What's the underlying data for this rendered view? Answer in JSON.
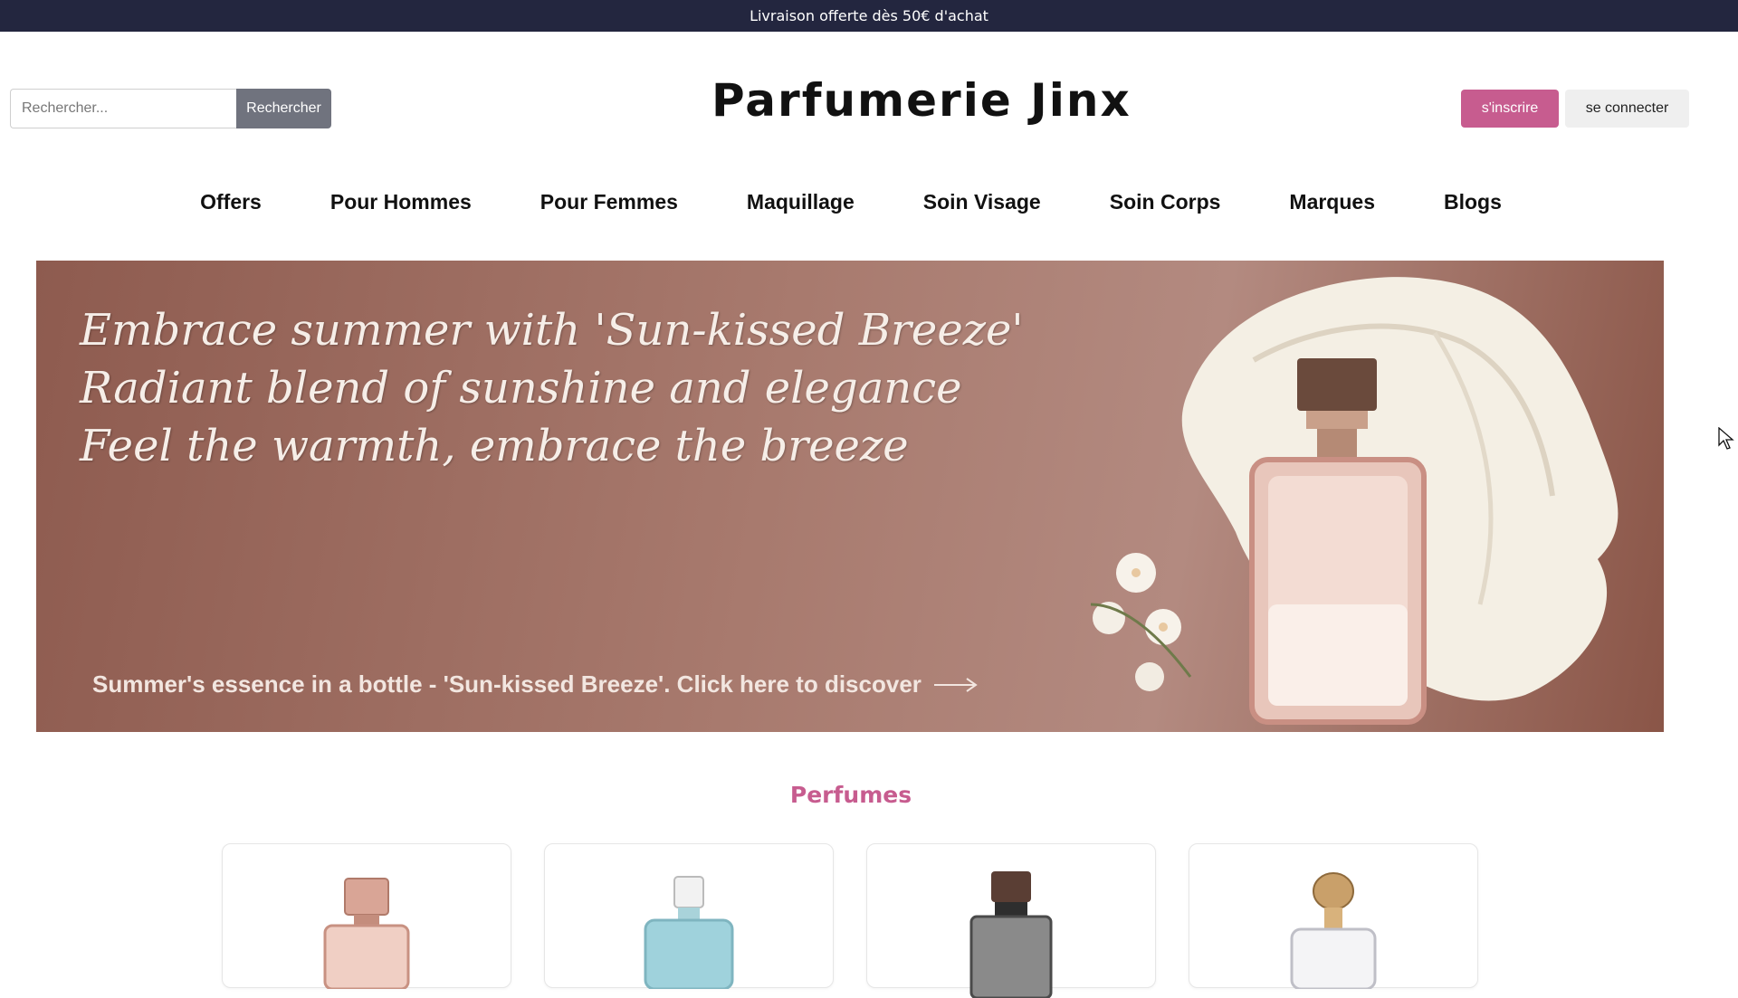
{
  "topbar": {
    "text": "Livraison offerte dès 50€ d'achat"
  },
  "search": {
    "placeholder": "Rechercher...",
    "button_label": "Rechercher"
  },
  "logo": {
    "text": "Parfumerie Jinx"
  },
  "auth": {
    "signup_label": "s'inscrire",
    "login_label": "se connecter"
  },
  "nav": {
    "items": [
      {
        "label": "Offers"
      },
      {
        "label": "Pour Hommes"
      },
      {
        "label": "Pour Femmes"
      },
      {
        "label": "Maquillage"
      },
      {
        "label": "Soin Visage"
      },
      {
        "label": "Soin Corps"
      },
      {
        "label": "Marques"
      },
      {
        "label": "Blogs"
      }
    ]
  },
  "hero": {
    "lines": [
      "Embrace summer with 'Sun-kissed Breeze'",
      "Radiant blend of sunshine and elegance",
      "Feel the warmth, embrace the breeze"
    ],
    "cta": "Summer's essence in a bottle - 'Sun-kissed Breeze'. Click here to discover"
  },
  "section": {
    "title": "Perfumes"
  },
  "colors": {
    "topbar_bg": "#23263f",
    "accent_pink": "#c75c8f",
    "search_button": "#70737e",
    "hero_bg": "#a87a6e"
  }
}
